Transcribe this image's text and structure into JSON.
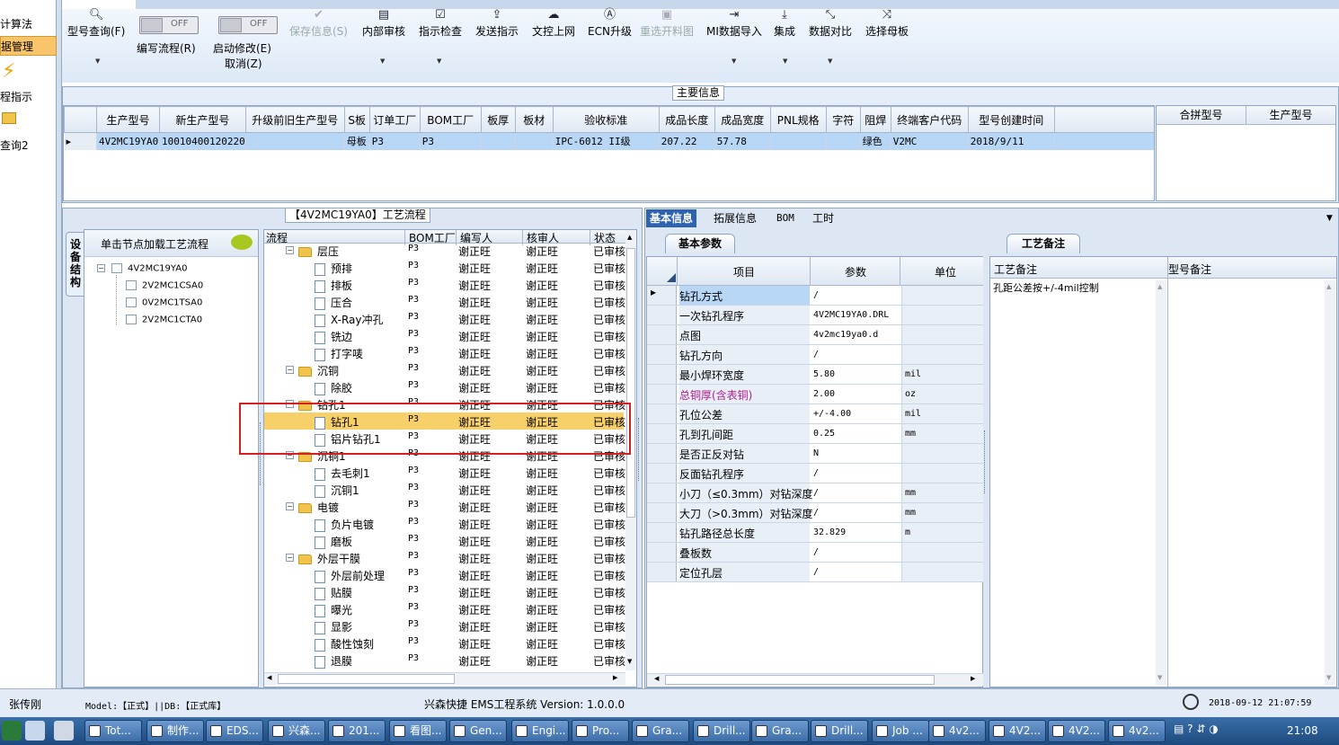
{
  "left_nav": {
    "items": [
      "计算法",
      "据管理",
      "程指示",
      "查询2"
    ]
  },
  "toolbar": {
    "buttons": [
      {
        "label": "型号查询(F)",
        "icon": "search-icon"
      },
      {
        "label": "保存信息(S)",
        "icon": "check-icon"
      },
      {
        "label": "内部审核",
        "icon": "printer-icon"
      },
      {
        "label": "指示检查",
        "icon": "checklist-icon"
      },
      {
        "label": "发送指示",
        "icon": "upload-icon"
      },
      {
        "label": "文控上网",
        "icon": "cloud-upload-icon"
      },
      {
        "label": "ECN升级",
        "icon": "ecn-icon"
      },
      {
        "label": "重选开料图",
        "icon": "image-icon"
      },
      {
        "label": "MI数据导入",
        "icon": "import-icon"
      },
      {
        "label": "集成",
        "icon": "download-icon"
      },
      {
        "label": "数据对比",
        "icon": "compare-icon"
      },
      {
        "label": "选择母板",
        "icon": "shuffle-icon"
      }
    ],
    "toggle1": {
      "state": "OFF",
      "label": "编写流程(R)"
    },
    "toggle2": {
      "state": "OFF",
      "label": "启动修改(E)",
      "sub": "取消(Z)"
    }
  },
  "main_info": {
    "title": "主要信息",
    "headers": [
      "生产型号",
      "新生产型号",
      "升级前旧生产型号",
      "S板",
      "订单工厂",
      "BOM工厂",
      "板厚",
      "板材",
      "验收标准",
      "成品长度",
      "成品宽度",
      "PNL规格",
      "字符",
      "阻焊",
      "终端客户代码",
      "型号创建时间"
    ],
    "row": [
      "4V2MC19YA0",
      "10010400120220",
      "",
      "母板",
      "P3",
      "P3",
      "",
      "",
      "IPC-6012 II级",
      "207.22",
      "57.78",
      "",
      "",
      "绿色",
      "V2MC",
      "2018/9/11"
    ],
    "merge_headers": [
      "合拼型号",
      "生产型号"
    ]
  },
  "flow_panel": {
    "title": "【4V2MC19YA0】工艺流程",
    "vertical_tab": "设备结构",
    "tree_header": "单击节点加载工艺流程",
    "tree_root": "4V2MC19YA0",
    "tree_children": [
      "2V2MC1CSA0",
      "0V2MC1TSA0",
      "2V2MC1CTA0"
    ],
    "grid_headers": [
      "流程",
      "BOM工厂",
      "编写人",
      "核审人",
      "状态"
    ],
    "rows": [
      {
        "name": "层压",
        "level": 0,
        "type": "folder",
        "bom": "P3",
        "writer": "谢正旺",
        "reviewer": "谢正旺",
        "status": "已审核"
      },
      {
        "name": "预排",
        "level": 1,
        "type": "file",
        "bom": "P3",
        "writer": "谢正旺",
        "reviewer": "谢正旺",
        "status": "已审核"
      },
      {
        "name": "排板",
        "level": 1,
        "type": "file",
        "bom": "P3",
        "writer": "谢正旺",
        "reviewer": "谢正旺",
        "status": "已审核"
      },
      {
        "name": "压合",
        "level": 1,
        "type": "file",
        "bom": "P3",
        "writer": "谢正旺",
        "reviewer": "谢正旺",
        "status": "已审核"
      },
      {
        "name": "X-Ray冲孔",
        "level": 1,
        "type": "file",
        "bom": "P3",
        "writer": "谢正旺",
        "reviewer": "谢正旺",
        "status": "已审核"
      },
      {
        "name": "铣边",
        "level": 1,
        "type": "file",
        "bom": "P3",
        "writer": "谢正旺",
        "reviewer": "谢正旺",
        "status": "已审核"
      },
      {
        "name": "打字唛",
        "level": 1,
        "type": "file",
        "bom": "P3",
        "writer": "谢正旺",
        "reviewer": "谢正旺",
        "status": "已审核"
      },
      {
        "name": "沉铜",
        "level": 0,
        "type": "folder",
        "bom": "P3",
        "writer": "谢正旺",
        "reviewer": "谢正旺",
        "status": "已审核"
      },
      {
        "name": "除胶",
        "level": 1,
        "type": "file",
        "bom": "P3",
        "writer": "谢正旺",
        "reviewer": "谢正旺",
        "status": "已审核"
      },
      {
        "name": "钻孔1",
        "level": 0,
        "type": "folder",
        "bom": "P3",
        "writer": "谢正旺",
        "reviewer": "谢正旺",
        "status": "已审核"
      },
      {
        "name": "钻孔1",
        "level": 1,
        "type": "file",
        "bom": "P3",
        "writer": "谢正旺",
        "reviewer": "谢正旺",
        "status": "已审核",
        "selected": true
      },
      {
        "name": "铝片钻孔1",
        "level": 1,
        "type": "file",
        "bom": "P3",
        "writer": "谢正旺",
        "reviewer": "谢正旺",
        "status": "已审核"
      },
      {
        "name": "沉铜1",
        "level": 0,
        "type": "folder",
        "bom": "P3",
        "writer": "谢正旺",
        "reviewer": "谢正旺",
        "status": "已审核"
      },
      {
        "name": "去毛刺1",
        "level": 1,
        "type": "file",
        "bom": "P3",
        "writer": "谢正旺",
        "reviewer": "谢正旺",
        "status": "已审核"
      },
      {
        "name": "沉铜1",
        "level": 1,
        "type": "file",
        "bom": "P3",
        "writer": "谢正旺",
        "reviewer": "谢正旺",
        "status": "已审核"
      },
      {
        "name": "电镀",
        "level": 0,
        "type": "folder",
        "bom": "P3",
        "writer": "谢正旺",
        "reviewer": "谢正旺",
        "status": "已审核"
      },
      {
        "name": "负片电镀",
        "level": 1,
        "type": "file",
        "bom": "P3",
        "writer": "谢正旺",
        "reviewer": "谢正旺",
        "status": "已审核"
      },
      {
        "name": "磨板",
        "level": 1,
        "type": "file",
        "bom": "P3",
        "writer": "谢正旺",
        "reviewer": "谢正旺",
        "status": "已审核"
      },
      {
        "name": "外层干膜",
        "level": 0,
        "type": "folder",
        "bom": "P3",
        "writer": "谢正旺",
        "reviewer": "谢正旺",
        "status": "已审核"
      },
      {
        "name": "外层前处理",
        "level": 1,
        "type": "file",
        "bom": "P3",
        "writer": "谢正旺",
        "reviewer": "谢正旺",
        "status": "已审核"
      },
      {
        "name": "贴膜",
        "level": 1,
        "type": "file",
        "bom": "P3",
        "writer": "谢正旺",
        "reviewer": "谢正旺",
        "status": "已审核"
      },
      {
        "name": "曝光",
        "level": 1,
        "type": "file",
        "bom": "P3",
        "writer": "谢正旺",
        "reviewer": "谢正旺",
        "status": "已审核"
      },
      {
        "name": "显影",
        "level": 1,
        "type": "file",
        "bom": "P3",
        "writer": "谢正旺",
        "reviewer": "谢正旺",
        "status": "已审核"
      },
      {
        "name": "酸性蚀刻",
        "level": 1,
        "type": "file",
        "bom": "P3",
        "writer": "谢正旺",
        "reviewer": "谢正旺",
        "status": "已审核"
      },
      {
        "name": "退膜",
        "level": 1,
        "type": "file",
        "bom": "P3",
        "writer": "谢正旺",
        "reviewer": "谢正旺",
        "status": "已审核"
      }
    ]
  },
  "right_panel": {
    "tabs": [
      "基本信息",
      "拓展信息",
      "BOM",
      "工时"
    ],
    "subtab": "基本参数",
    "headers": [
      "项目",
      "参数",
      "单位"
    ],
    "rows": [
      {
        "item": "钻孔方式",
        "param": "/",
        "unit": ""
      },
      {
        "item": "一次钻孔程序",
        "param": "4V2MC19YA0.DRL",
        "unit": ""
      },
      {
        "item": "点图",
        "param": "4v2mc19ya0.d",
        "unit": ""
      },
      {
        "item": "钻孔方向",
        "param": "/",
        "unit": ""
      },
      {
        "item": "最小焊环宽度",
        "param": "5.80",
        "unit": "mil"
      },
      {
        "item": "总铜厚(含表铜)",
        "param": "2.00",
        "unit": "oz",
        "highlight": true
      },
      {
        "item": "孔位公差",
        "param": "+/-4.00",
        "unit": "mil"
      },
      {
        "item": "孔到孔间距",
        "param": "0.25",
        "unit": "mm"
      },
      {
        "item": "是否正反对钻",
        "param": "N",
        "unit": ""
      },
      {
        "item": "反面钻孔程序",
        "param": "/",
        "unit": ""
      },
      {
        "item": "小刀（≤0.3mm）对钻深度",
        "param": "/",
        "unit": "mm"
      },
      {
        "item": "大刀（>0.3mm）对钻深度",
        "param": "/",
        "unit": "mm"
      },
      {
        "item": "钻孔路径总长度",
        "param": "32.829",
        "unit": "m"
      },
      {
        "item": "叠板数",
        "param": "/",
        "unit": ""
      },
      {
        "item": "定位孔层",
        "param": "/",
        "unit": ""
      }
    ],
    "remark_tab": "工艺备注",
    "remark_headers": [
      "工艺备注",
      "型号备注"
    ],
    "remark_text": "孔距公差按+/-4mil控制"
  },
  "status_bar": {
    "user": "张传刚",
    "model_info": "Model:【正式】||DB:【正式库】",
    "app_title": "兴森快捷 EMS工程系统 Version: 1.0.0.0",
    "datetime": "2018-09-12 21:07:59"
  },
  "taskbar": {
    "items": [
      "Tot...",
      "制作...",
      "EDS...",
      "兴森...",
      "201...",
      "看图...",
      "Gen...",
      "Engi...",
      "Pro...",
      "Gra...",
      "Drill...",
      "Gra...",
      "Drill...",
      "Job ...",
      "4v2...",
      "4V2...",
      "4V2...",
      "4v2..."
    ],
    "clock": "21:08"
  },
  "colors": {
    "selection": "#f8d06a",
    "highlight_red": "#d62020",
    "row_selected_blue": "#b8d6f5",
    "tab_active": "#2e63b0",
    "magenta_text": "#b0208c"
  }
}
